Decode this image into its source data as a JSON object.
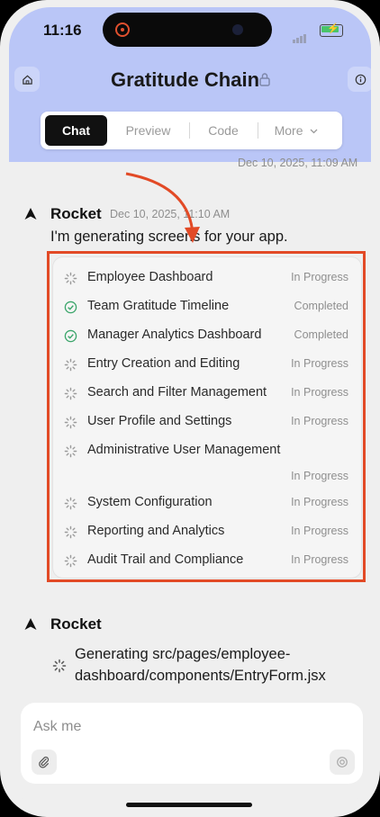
{
  "status_bar": {
    "time": "11:16"
  },
  "header": {
    "title": "Gratitude Chain",
    "tabs": [
      {
        "label": "Chat",
        "active": true
      },
      {
        "label": "Preview",
        "active": false
      },
      {
        "label": "Code",
        "active": false
      },
      {
        "label": "More",
        "active": false
      }
    ]
  },
  "chat": {
    "previous_timestamp": "Dec 10, 2025, 11:09 AM",
    "message1": {
      "sender": "Rocket",
      "timestamp": "Dec 10, 2025, 11:10 AM",
      "text": "I'm generating screens for your app.",
      "screens": [
        {
          "name": "Employee Dashboard",
          "status": "In Progress",
          "done": false
        },
        {
          "name": "Team Gratitude Timeline",
          "status": "Completed",
          "done": true
        },
        {
          "name": "Manager Analytics Dashboard",
          "status": "Completed",
          "done": true
        },
        {
          "name": "Entry Creation and Editing",
          "status": "In Progress",
          "done": false
        },
        {
          "name": "Search and Filter Management",
          "status": "In Progress",
          "done": false
        },
        {
          "name": "User Profile and Settings",
          "status": "In Progress",
          "done": false
        },
        {
          "name": "Administrative User Management",
          "status": "In Progress",
          "done": false
        },
        {
          "name": "System Configuration",
          "status": "In Progress",
          "done": false
        },
        {
          "name": "Reporting and Analytics",
          "status": "In Progress",
          "done": false
        },
        {
          "name": "Audit Trail and Compliance",
          "status": "In Progress",
          "done": false
        }
      ]
    },
    "message2": {
      "sender": "Rocket",
      "generating_line1": "Generating src/pages/employee-",
      "generating_line2": "dashboard/components/EntryForm.jsx"
    }
  },
  "composer": {
    "placeholder": "Ask me"
  },
  "colors": {
    "header_bg": "#bac6f7",
    "annotation": "#e24a26",
    "completed_check": "#3aa56a"
  }
}
